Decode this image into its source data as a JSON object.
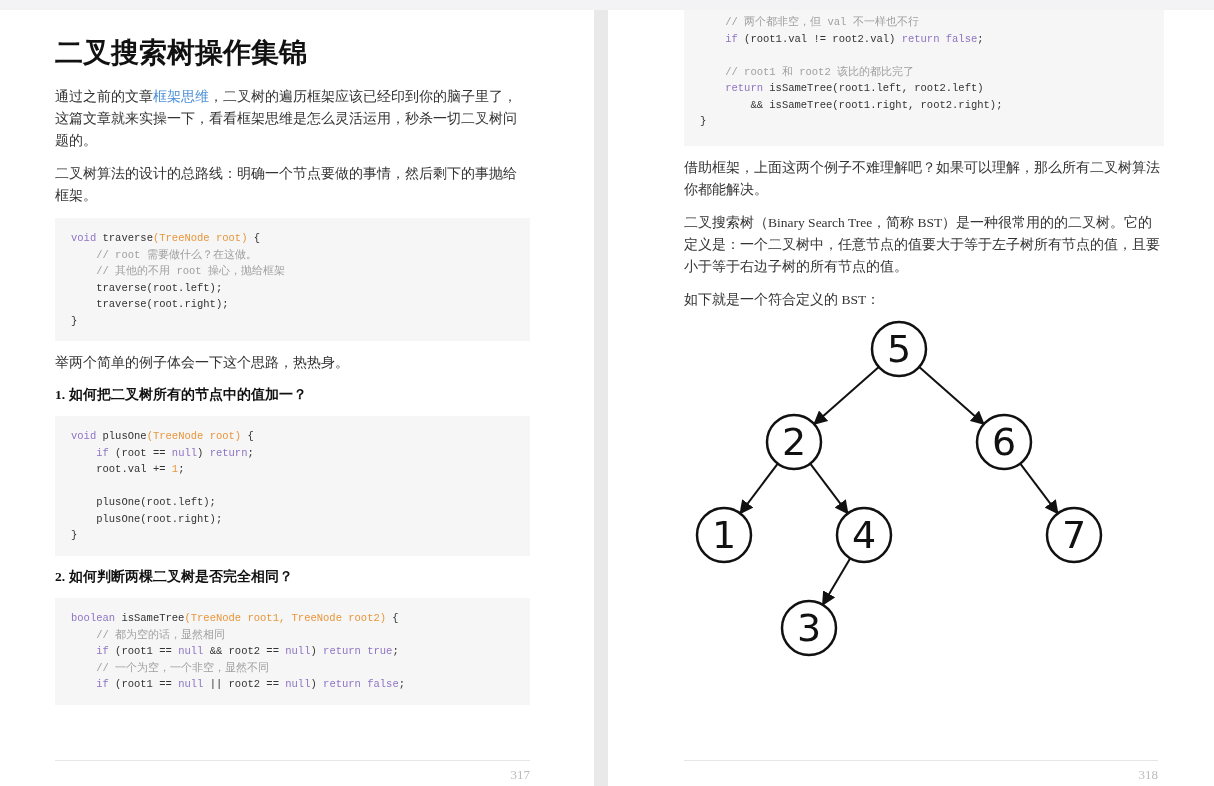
{
  "left_page": {
    "title": "二叉搜索树操作集锦",
    "blocks": [
      {
        "kind": "para",
        "parts": [
          {
            "kind": "text",
            "text": "通过之前的文章"
          },
          {
            "kind": "link",
            "text": "框架思维"
          },
          {
            "kind": "text",
            "text": "，二叉树的遍历框架应该已经印到你的脑子里了，这篇文章就来实操一下，看看框架思维是怎么灵活运用，秒杀一切二叉树问题的。"
          }
        ]
      },
      {
        "kind": "para",
        "parts": [
          {
            "kind": "text",
            "text": "二叉树算法的设计的总路线：明确一个节点要做的事情，然后剩下的事抛给框架。"
          }
        ]
      },
      {
        "kind": "code",
        "lines": [
          {
            "kind": "code",
            "tokens": [
              {
                "kind": "k",
                "text": "void"
              },
              {
                "kind": "p",
                "text": " traverse"
              },
              {
                "kind": "o",
                "text": "(TreeNode root)"
              },
              {
                "kind": "p",
                "text": " {"
              }
            ]
          },
          {
            "kind": "code",
            "tokens": [
              {
                "kind": "c",
                "text": "    // root 需要做什么？在这做。"
              }
            ]
          },
          {
            "kind": "code",
            "tokens": [
              {
                "kind": "c",
                "text": "    // 其他的不用 root 操心，抛给框架"
              }
            ]
          },
          {
            "kind": "code",
            "tokens": [
              {
                "kind": "p",
                "text": "    traverse(root.left);"
              }
            ]
          },
          {
            "kind": "code",
            "tokens": [
              {
                "kind": "p",
                "text": "    traverse(root.right);"
              }
            ]
          },
          {
            "kind": "code",
            "tokens": [
              {
                "kind": "p",
                "text": "}"
              }
            ]
          }
        ]
      },
      {
        "kind": "para",
        "parts": [
          {
            "kind": "text",
            "text": "举两个简单的例子体会一下这个思路，热热身。"
          }
        ]
      },
      {
        "kind": "heading",
        "text": "1. 如何把二叉树所有的节点中的值加一？"
      },
      {
        "kind": "code",
        "lines": [
          {
            "kind": "code",
            "tokens": [
              {
                "kind": "k",
                "text": "void"
              },
              {
                "kind": "p",
                "text": " plusOne"
              },
              {
                "kind": "o",
                "text": "(TreeNode root)"
              },
              {
                "kind": "p",
                "text": " {"
              }
            ]
          },
          {
            "kind": "code",
            "tokens": [
              {
                "kind": "k",
                "text": "    if"
              },
              {
                "kind": "p",
                "text": " (root == "
              },
              {
                "kind": "k",
                "text": "null"
              },
              {
                "kind": "p",
                "text": ") "
              },
              {
                "kind": "k",
                "text": "return"
              },
              {
                "kind": "p",
                "text": ";"
              }
            ]
          },
          {
            "kind": "code",
            "tokens": [
              {
                "kind": "p",
                "text": "    root.val += "
              },
              {
                "kind": "o",
                "text": "1"
              },
              {
                "kind": "p",
                "text": ";"
              }
            ]
          },
          {
            "kind": "blank"
          },
          {
            "kind": "code",
            "tokens": [
              {
                "kind": "p",
                "text": "    plusOne(root.left);"
              }
            ]
          },
          {
            "kind": "code",
            "tokens": [
              {
                "kind": "p",
                "text": "    plusOne(root.right);"
              }
            ]
          },
          {
            "kind": "code",
            "tokens": [
              {
                "kind": "p",
                "text": "}"
              }
            ]
          }
        ]
      },
      {
        "kind": "heading",
        "text": "2. 如何判断两棵二叉树是否完全相同？"
      },
      {
        "kind": "code",
        "lines": [
          {
            "kind": "code",
            "tokens": [
              {
                "kind": "k",
                "text": "boolean"
              },
              {
                "kind": "p",
                "text": " isSameTree"
              },
              {
                "kind": "o",
                "text": "(TreeNode root1, TreeNode root2)"
              },
              {
                "kind": "p",
                "text": " {"
              }
            ]
          },
          {
            "kind": "code",
            "tokens": [
              {
                "kind": "c",
                "text": "    // 都为空的话，显然相同"
              }
            ]
          },
          {
            "kind": "code",
            "tokens": [
              {
                "kind": "k",
                "text": "    if"
              },
              {
                "kind": "p",
                "text": " (root1 == "
              },
              {
                "kind": "k",
                "text": "null"
              },
              {
                "kind": "p",
                "text": " && root2 == "
              },
              {
                "kind": "k",
                "text": "null"
              },
              {
                "kind": "p",
                "text": ") "
              },
              {
                "kind": "k",
                "text": "return true"
              },
              {
                "kind": "p",
                "text": ";"
              }
            ]
          },
          {
            "kind": "code",
            "tokens": [
              {
                "kind": "c",
                "text": "    // 一个为空，一个非空，显然不同"
              }
            ]
          },
          {
            "kind": "code",
            "tokens": [
              {
                "kind": "k",
                "text": "    if"
              },
              {
                "kind": "p",
                "text": " (root1 == "
              },
              {
                "kind": "k",
                "text": "null"
              },
              {
                "kind": "p",
                "text": " || root2 == "
              },
              {
                "kind": "k",
                "text": "null"
              },
              {
                "kind": "p",
                "text": ") "
              },
              {
                "kind": "k",
                "text": "return false"
              },
              {
                "kind": "p",
                "text": ";"
              }
            ]
          }
        ]
      }
    ],
    "page_number": "317"
  },
  "right_page": {
    "blocks": [
      {
        "kind": "code",
        "lines": [
          {
            "kind": "code",
            "tokens": [
              {
                "kind": "c",
                "text": "    // 两个都非空，但 val 不一样也不行"
              }
            ]
          },
          {
            "kind": "code",
            "tokens": [
              {
                "kind": "k",
                "text": "    if"
              },
              {
                "kind": "p",
                "text": " (root1.val != root2.val) "
              },
              {
                "kind": "k",
                "text": "return false"
              },
              {
                "kind": "p",
                "text": ";"
              }
            ]
          },
          {
            "kind": "blank"
          },
          {
            "kind": "code",
            "tokens": [
              {
                "kind": "c",
                "text": "    // root1 和 root2 该比的都比完了"
              }
            ]
          },
          {
            "kind": "code",
            "tokens": [
              {
                "kind": "k",
                "text": "    return"
              },
              {
                "kind": "p",
                "text": " isSameTree(root1.left, root2.left)"
              }
            ]
          },
          {
            "kind": "code",
            "tokens": [
              {
                "kind": "p",
                "text": "        && isSameTree(root1.right, root2.right);"
              }
            ]
          },
          {
            "kind": "code",
            "tokens": [
              {
                "kind": "p",
                "text": "}"
              }
            ]
          }
        ]
      },
      {
        "kind": "para",
        "parts": [
          {
            "kind": "text",
            "text": "借助框架，上面这两个例子不难理解吧？如果可以理解，那么所有二叉树算法你都能解决。"
          }
        ]
      },
      {
        "kind": "para",
        "parts": [
          {
            "kind": "text",
            "text": "二叉搜索树（Binary Search Tree，简称 BST）是一种很常用的的二叉树。它的定义是：一个二叉树中，任意节点的值要大于等于左子树所有节点的值，且要小于等于右边子树的所有节点的值。"
          }
        ]
      },
      {
        "kind": "para",
        "parts": [
          {
            "kind": "text",
            "text": "如下就是一个符合定义的 BST："
          }
        ]
      }
    ],
    "tree": {
      "label": "5",
      "left": {
        "label": "2",
        "left": {
          "label": "1"
        },
        "right": {
          "label": "4",
          "left": {
            "label": "3"
          }
        }
      },
      "right": {
        "label": "6",
        "right": {
          "label": "7"
        }
      }
    },
    "page_number": "318"
  }
}
